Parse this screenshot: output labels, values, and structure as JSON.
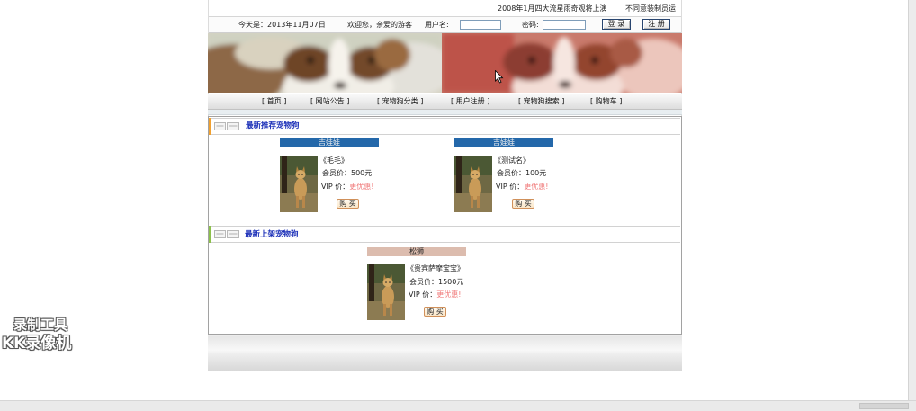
{
  "marquee": {
    "news": "2008年1月四大流星雨奇观将上演",
    "notice": "不同意装制员运"
  },
  "login_bar": {
    "date": "今天是：2013年11月07日",
    "welcome": "欢迎您，亲爱的游客",
    "username_label": "用户名:",
    "username_value": "",
    "password_label": "密码:",
    "password_value": "",
    "login_button": "登 录",
    "register_button": "注 册"
  },
  "nav": {
    "items": [
      "[ 首页 ]",
      "[ 网站公告 ]",
      "[ 宠物狗分类 ]",
      "[ 用户注册 ]",
      "[ 宠物狗搜索 ]",
      "[ 购物车 ]"
    ]
  },
  "sections": [
    {
      "title": "最新推荐宠物狗",
      "icon": "section-badge-icon",
      "accent_color": "#f0a030",
      "products": [
        {
          "category": "吉娃娃",
          "category_color": "#2468aa",
          "image": "dog-photo-icon",
          "name": "《毛毛》",
          "member_price": "会员价：500元",
          "vip_label": "VIP 价：",
          "vip_value": "更优惠!",
          "buy_button": "购 买"
        },
        {
          "category": "吉娃娃",
          "category_color": "#2468aa",
          "image": "dog-photo-icon",
          "name": "《测试名》",
          "member_price": "会员价：100元",
          "vip_label": "VIP 价：",
          "vip_value": "更优惠!",
          "buy_button": "购 买"
        }
      ]
    },
    {
      "title": "最新上架宠物狗",
      "icon": "section-badge-icon",
      "accent_color": "#8cc04c",
      "products": [
        {
          "category": "松狮",
          "category_color": "#dcbcae",
          "image": "dog-photo-icon",
          "name": "《贵宾萨摩宝宝》",
          "member_price": "会员价：1500元",
          "vip_label": "VIP 价：",
          "vip_value": "更优惠!",
          "buy_button": "购 买"
        }
      ]
    }
  ],
  "icons": {
    "banner_left": "papillon-dog-banner-icon",
    "banner_right": "papillon-dog-banner-red-icon",
    "cursor": "arrow-cursor-icon"
  },
  "watermark": {
    "line1": "录制工具",
    "line2": "KK录像机"
  },
  "colors": {
    "title_blue": "#1c30b8",
    "vip_highlight": "#f07878",
    "buy_button_border": "#d0905a"
  }
}
